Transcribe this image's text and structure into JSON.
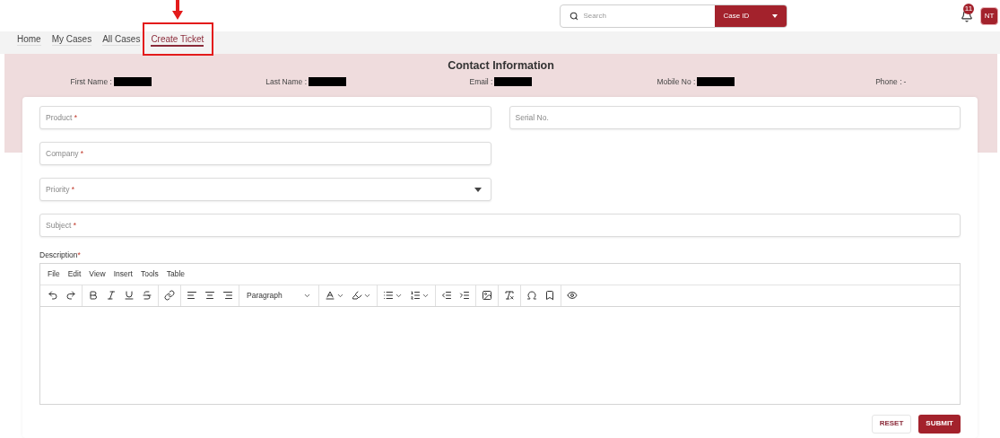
{
  "header": {
    "search": {
      "placeholder": "Search"
    },
    "search_type": "Case ID",
    "notifications": "11",
    "avatar": "NT"
  },
  "nav": [
    {
      "label": "Home",
      "selected": false,
      "annotated": false
    },
    {
      "label": "My Cases",
      "selected": false,
      "annotated": false
    },
    {
      "label": "All Cases",
      "selected": false,
      "annotated": false
    },
    {
      "label": "Create Ticket",
      "selected": true,
      "annotated": true
    }
  ],
  "contact": {
    "title": "Contact Information",
    "items": [
      {
        "label": "First Name :",
        "redacted": true
      },
      {
        "label": "Last Name :",
        "redacted": true
      },
      {
        "label": "Email :",
        "redacted": true
      },
      {
        "label": "Mobile No :",
        "redacted": true
      },
      {
        "label": "Phone :",
        "value": "-",
        "redacted": false
      }
    ]
  },
  "fields": [
    {
      "kind": "text",
      "label": "Product",
      "required_mark": "*"
    },
    {
      "kind": "text",
      "label": "Serial No."
    },
    {
      "kind": "text",
      "label": "Company",
      "required_mark": "*"
    },
    {
      "kind": "select",
      "label": "Priority",
      "required_mark": "*"
    },
    {
      "kind": "text",
      "label": "Subject",
      "required_mark": "*"
    }
  ],
  "description": {
    "label": "Description",
    "required_mark": "*",
    "menu": [
      "File",
      "Edit",
      "View",
      "Insert",
      "Tools",
      "Table"
    ],
    "format_select": "Paragraph"
  },
  "buttons": [
    {
      "kind": "secondary",
      "label": "RESET"
    },
    {
      "kind": "primary",
      "label": "SUBMIT"
    }
  ]
}
